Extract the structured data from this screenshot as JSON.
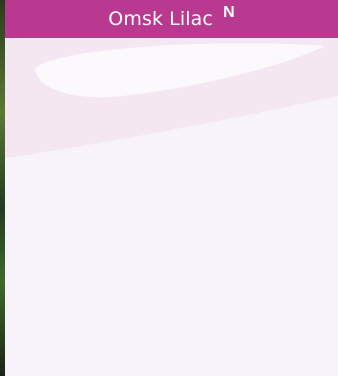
{
  "header": {
    "title": "Omsk Lilac",
    "badge": "N",
    "background_color": "#b8398f",
    "text_color": "#ffffff"
  },
  "panel": {
    "background_color": "#f8f3fa"
  }
}
